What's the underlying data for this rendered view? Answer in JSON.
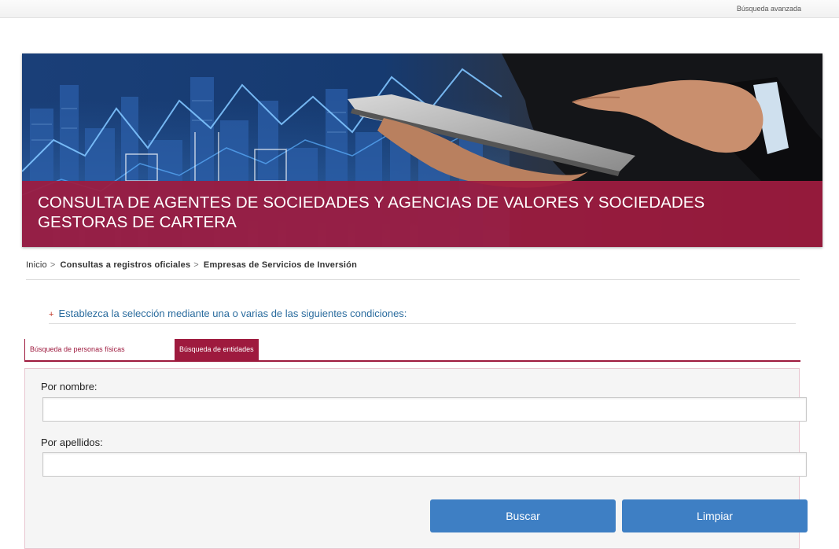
{
  "topbar": {
    "link": "Búsqueda avanzada"
  },
  "banner": {
    "title": "CONSULTA DE AGENTES DE SOCIEDADES Y AGENCIAS DE VALORES Y SOCIEDADES GESTORAS DE CARTERA"
  },
  "breadcrumb": {
    "items": [
      "Inicio",
      "Consultas a registros oficiales",
      "Empresas de Servicios de Inversión"
    ],
    "separator": ">"
  },
  "instruction": {
    "bullet": "+",
    "text": "Establezca la selección mediante una o varias de las siguientes condiciones:"
  },
  "tabs": [
    {
      "label": "Búsqueda de personas físicas",
      "active": true
    },
    {
      "label": "Búsqueda de entidades",
      "active": false
    }
  ],
  "form": {
    "nombre_label": "Por nombre:",
    "nombre_value": "",
    "apellidos_label": "Por apellidos:",
    "apellidos_value": "",
    "search_label": "Buscar",
    "clear_label": "Limpiar"
  },
  "colors": {
    "accent": "#9e1a3e",
    "button": "#3e7fc4",
    "link": "#2b6c9e"
  }
}
